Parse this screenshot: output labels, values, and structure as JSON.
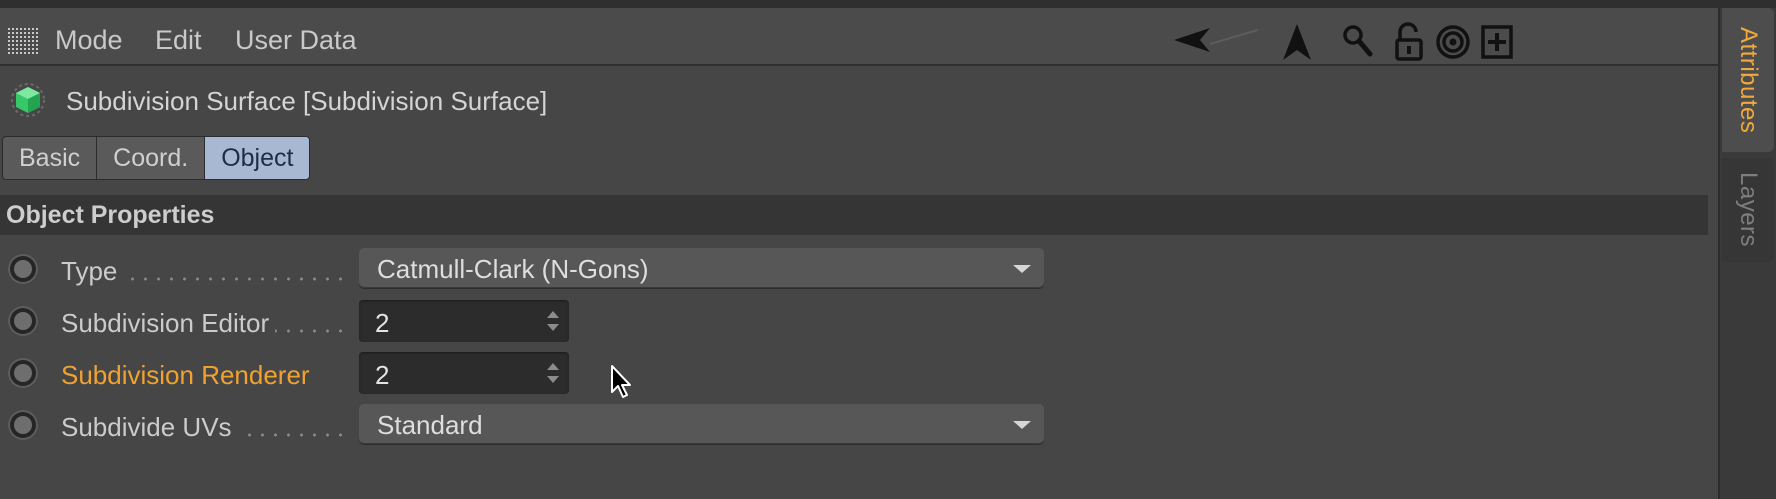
{
  "menubar": {
    "items": [
      "Mode",
      "Edit",
      "User Data"
    ]
  },
  "toolbar": {
    "icons": [
      "arrow-left-icon",
      "arrow-up-icon",
      "search-icon",
      "lock-icon",
      "target-icon",
      "new-panel-icon"
    ]
  },
  "side_tabs": [
    {
      "label": "Attributes",
      "active": true
    },
    {
      "label": "Layers",
      "active": false
    }
  ],
  "object": {
    "title": "Subdivision Surface [Subdivision Surface]",
    "icon": "subdivision-surface-icon"
  },
  "tabs": [
    {
      "label": "Basic",
      "active": false
    },
    {
      "label": "Coord.",
      "active": false
    },
    {
      "label": "Object",
      "active": true
    }
  ],
  "section": {
    "title": "Object Properties"
  },
  "properties": [
    {
      "label": "Type",
      "control": "dropdown",
      "value": "Catmull-Clark (N-Gons)"
    },
    {
      "label": "Subdivision Editor",
      "control": "number",
      "value": "2"
    },
    {
      "label": "Subdivision Renderer",
      "control": "number",
      "value": "2",
      "highlighted": true
    },
    {
      "label": "Subdivide UVs",
      "control": "dropdown",
      "value": "Standard"
    }
  ],
  "colors": {
    "accent": "#f0a230",
    "active_tab": "#a9b8d2",
    "panel": "#464646",
    "section": "#353535"
  }
}
